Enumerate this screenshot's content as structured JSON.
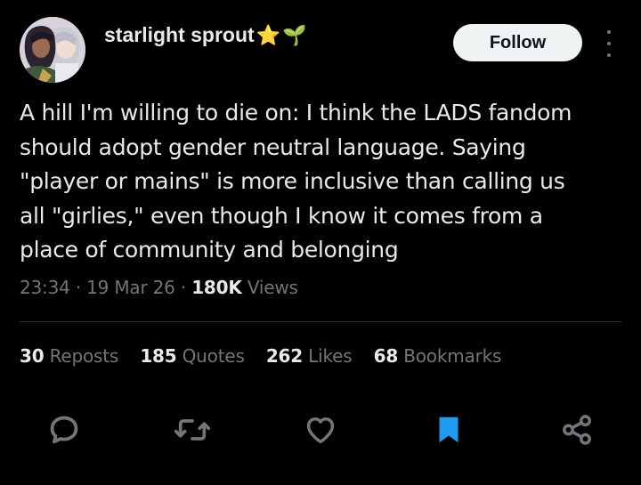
{
  "user": {
    "display_name": "starlight sprout",
    "emoji_star": "⭐",
    "emoji_sprout": "🌱",
    "follow_label": "Follow"
  },
  "tweet": {
    "text": "A hill I'm willing to die on: I think the LADS fandom\nshould adopt gender neutral language. Saying\n\"player or mains\" is more inclusive than calling us\nall \"girlies,\" even though I know it comes from a\nplace of community and belonging",
    "time": "23:34",
    "date": "19 Mar 26",
    "views_count": "180K",
    "views_label": "Views"
  },
  "stats": [
    {
      "count": "30",
      "label": "Reposts"
    },
    {
      "count": "185",
      "label": "Quotes"
    },
    {
      "count": "262",
      "label": "Likes"
    },
    {
      "count": "68",
      "label": "Bookmarks"
    }
  ],
  "icons": {
    "reply": "reply-icon",
    "repost": "repost-icon",
    "like": "heart-icon",
    "bookmark": "bookmark-icon",
    "share": "share-icon"
  },
  "colors": {
    "background": "#000000",
    "text_primary": "#e7e9ea",
    "text_secondary": "#71767b",
    "bookmark_active": "#1d9bf0",
    "follow_button_bg": "#eff3f4"
  }
}
